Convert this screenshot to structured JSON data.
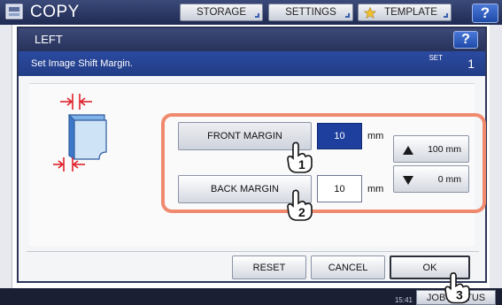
{
  "app": {
    "title": "COPY",
    "tabs": [
      {
        "label": "STORAGE"
      },
      {
        "label": "SETTINGS"
      },
      {
        "label": "TEMPLATE"
      }
    ],
    "help_label": "?"
  },
  "dialog": {
    "title": "LEFT",
    "help_label": "?",
    "subtitle": "Set Image Shift Margin.",
    "set_label": "SET",
    "set_number": "1",
    "front_margin_label": "FRONT MARGIN",
    "front_margin_value": "10",
    "back_margin_label": "BACK MARGIN",
    "back_margin_value": "10",
    "unit": "mm",
    "up_label": "100 mm",
    "down_label": "0 mm",
    "reset_label": "RESET",
    "cancel_label": "CANCEL",
    "ok_label": "OK"
  },
  "status": {
    "time": "15:41",
    "job_status_label": "JOB STATUS"
  },
  "markers": [
    "1",
    "2",
    "3"
  ],
  "colors": {
    "accent": "#1f3f9e",
    "highlight_frame": "#f08a6e",
    "arrow_red": "#e0202a"
  }
}
